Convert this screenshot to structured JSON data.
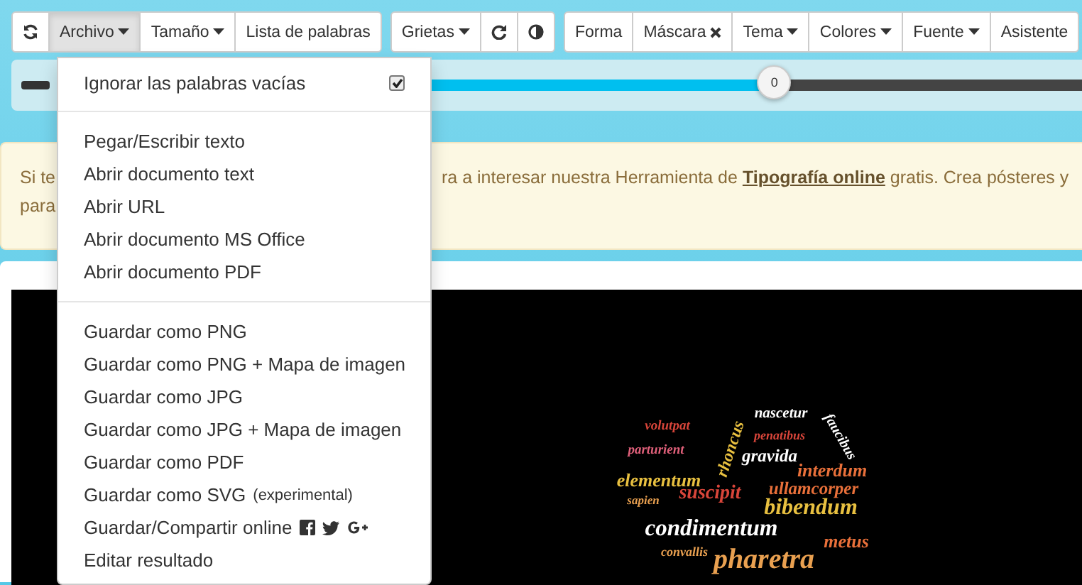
{
  "toolbar": {
    "groups": [
      [
        {
          "kind": "icon",
          "selected": false
        },
        {
          "kind": "dropdown",
          "label": "Archivo",
          "selected": true
        },
        {
          "kind": "dropdown",
          "label": "Tamaño",
          "selected": false
        },
        {
          "kind": "text",
          "label": "Lista de palabras",
          "selected": false
        }
      ],
      [
        {
          "kind": "dropdown",
          "label": "Grietas",
          "selected": false
        },
        {
          "kind": "icon",
          "selected": false
        },
        {
          "kind": "icon",
          "selected": false
        }
      ],
      [
        {
          "kind": "text",
          "label": "Forma",
          "selected": false
        },
        {
          "kind": "close",
          "label": "Máscara",
          "selected": false
        },
        {
          "kind": "dropdown",
          "label": "Tema",
          "selected": false
        },
        {
          "kind": "dropdown",
          "label": "Colores",
          "selected": false
        },
        {
          "kind": "dropdown",
          "label": "Fuente",
          "selected": false
        },
        {
          "kind": "text",
          "label": "Asistente",
          "selected": false
        }
      ]
    ]
  },
  "slider": {
    "level": 0.7,
    "reading": "0"
  },
  "alert": {
    "line_1_start": "Si te",
    "line_1_end": "ra a interesar nuestra Herramienta de **Tipografía online** gratis. Crea pósteres y",
    "line_2_start": "para"
  },
  "menu": {
    "sections": [
      [
        {
          "kind": "check",
          "label": "Ignorar las palabras vacías",
          "checked": true
        }
      ],
      [
        {
          "kind": "item",
          "label": "Pegar/Escribir texto"
        },
        {
          "kind": "item",
          "label": "Abrir documento text"
        },
        {
          "kind": "item",
          "label": "Abrir URL"
        },
        {
          "kind": "item",
          "label": "Abrir documento MS Office"
        },
        {
          "kind": "item",
          "label": "Abrir documento PDF"
        }
      ],
      [
        {
          "kind": "item",
          "label": "Guardar como PNG"
        },
        {
          "kind": "item",
          "label": "Guardar como PNG + Mapa de imagen"
        },
        {
          "kind": "item",
          "label": "Guardar como JPG"
        },
        {
          "kind": "item",
          "label": "Guardar como JPG + Mapa de imagen"
        },
        {
          "kind": "item",
          "label": "Guardar como PDF"
        },
        {
          "kind": "item",
          "label": "Guardar como SVG",
          "note": "(experimental)"
        },
        {
          "kind": "share",
          "label": "Guardar/Compartir online"
        },
        {
          "kind": "item",
          "label": "Editar resultado"
        }
      ]
    ]
  },
  "word_cloud": {
    "words": [
      {
        "text": "volutpat",
        "color": "#d8453a"
      },
      {
        "text": "nascetur",
        "color": "#ffffff"
      },
      {
        "text": "faucibus",
        "color": "#ffffff"
      },
      {
        "text": "parturient",
        "color": "#e0607a"
      },
      {
        "text": "rhoncus",
        "color": "#e8c040"
      },
      {
        "text": "penatibus",
        "color": "#d8453a"
      },
      {
        "text": "gravida",
        "color": "#ffffff"
      },
      {
        "text": "elementum",
        "color": "#e8c040"
      },
      {
        "text": "interdum",
        "color": "#e9703a"
      },
      {
        "text": "sapien",
        "color": "#e9a050"
      },
      {
        "text": "suscipit",
        "color": "#d8453a"
      },
      {
        "text": "ullamcorper",
        "color": "#e9703a"
      },
      {
        "text": "bibendum",
        "color": "#e8c040"
      },
      {
        "text": "condimentum",
        "color": "#ffffff"
      },
      {
        "text": "metus",
        "color": "#e9703a"
      },
      {
        "text": "convallis",
        "color": "#e9a050"
      },
      {
        "text": "pharetra",
        "color": "#e9a050"
      }
    ]
  }
}
